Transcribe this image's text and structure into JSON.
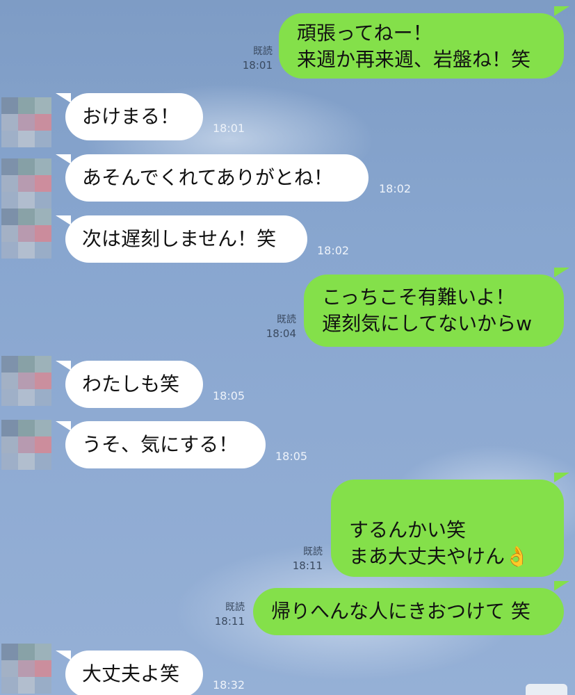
{
  "colors": {
    "outgoing_bubble": "#84e04a",
    "incoming_bubble": "#ffffff",
    "background": "#88a6cf"
  },
  "messages": [
    {
      "id": "m1",
      "direction": "out",
      "text": "頑張ってねー！\n来週か再来週、岩盤ね！笑",
      "read": "既読",
      "time": "18:01"
    },
    {
      "id": "m2",
      "direction": "in",
      "text": "おけまる！",
      "time": "18:01"
    },
    {
      "id": "m3",
      "direction": "in",
      "text": "あそんでくれてありがとね！",
      "time": "18:02"
    },
    {
      "id": "m4",
      "direction": "in",
      "text": "次は遅刻しません！笑",
      "time": "18:02"
    },
    {
      "id": "m5",
      "direction": "out",
      "text": "こっちこそ有難いよ！\n遅刻気にしてないからw",
      "read": "既読",
      "time": "18:04"
    },
    {
      "id": "m6",
      "direction": "in",
      "text": "わたしも笑",
      "time": "18:05"
    },
    {
      "id": "m7",
      "direction": "in",
      "text": "うそ、気にする！",
      "time": "18:05"
    },
    {
      "id": "m8",
      "direction": "out",
      "text": "するんかい笑\nまあ大丈夫やけん",
      "emoji": "👌",
      "emoji_name": "ok-hand-icon",
      "read": "既読",
      "time": "18:11"
    },
    {
      "id": "m9",
      "direction": "out",
      "text": "帰りへんな人にきおつけて 笑",
      "read": "既読",
      "time": "18:11"
    },
    {
      "id": "m10",
      "direction": "in",
      "text": "大丈夫よ笑",
      "time": "18:32"
    }
  ]
}
